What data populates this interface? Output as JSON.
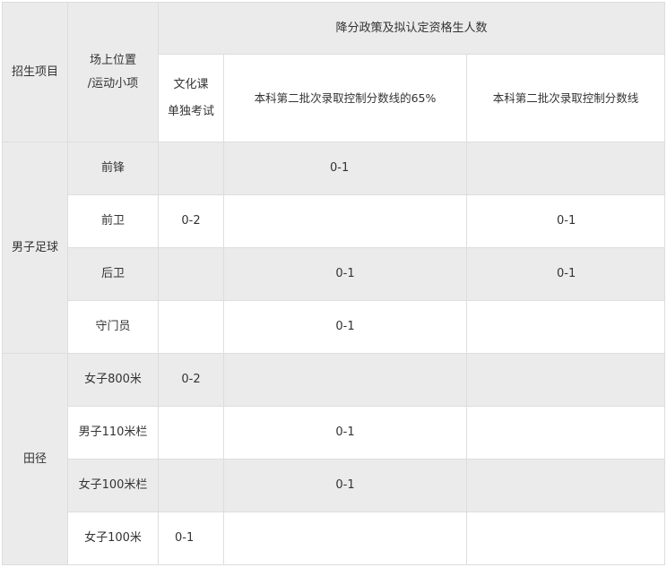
{
  "table": {
    "header": {
      "project": "招生项目",
      "position": [
        "场上位置",
        "/运动小项"
      ],
      "group": "降分政策及拟认定资格生人数",
      "sub": {
        "culture": [
          "文化课",
          "单独考试"
        ],
        "pct65": "本科第二批次录取控制分数线的65%",
        "line": "本科第二批次录取控制分数线"
      }
    },
    "groups": [
      {
        "name": "男子足球"
      },
      {
        "name": "田径"
      }
    ],
    "rows": [
      {
        "position": "前锋",
        "culture": "",
        "pct65": "0-1",
        "line": ""
      },
      {
        "position": "前卫",
        "culture": "0-2",
        "pct65": "",
        "line": "0-1"
      },
      {
        "position": "后卫",
        "culture": "",
        "pct65": "0-1",
        "line": "0-1"
      },
      {
        "position": "守门员",
        "culture": "",
        "pct65": "0-1",
        "line": ""
      },
      {
        "position": "女子800米",
        "culture": "0-2",
        "pct65": "",
        "line": ""
      },
      {
        "position": "男子110米栏",
        "culture": "",
        "pct65": "0-1",
        "line": ""
      },
      {
        "position": "女子100米栏",
        "culture": "",
        "pct65": "0-1",
        "line": ""
      },
      {
        "position": "女子100米",
        "culture": "0-1",
        "pct65": "",
        "line": ""
      }
    ]
  }
}
